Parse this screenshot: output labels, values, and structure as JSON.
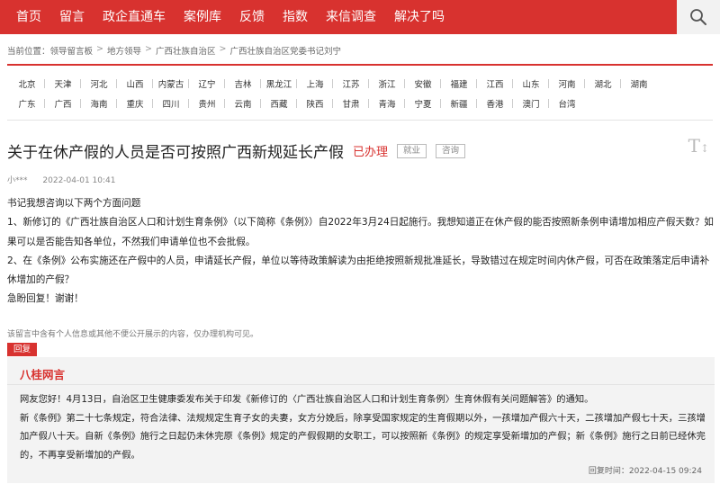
{
  "nav": {
    "items": [
      "首页",
      "留言",
      "政企直通车",
      "案例库",
      "反馈",
      "指数",
      "来信调查",
      "解决了吗"
    ]
  },
  "search": {
    "icon": "search-icon"
  },
  "breadcrumb": {
    "label": "当前位置：",
    "items": [
      "领导留言板",
      "地方领导",
      "广西壮族自治区",
      "广西壮族自治区党委书记刘宁"
    ],
    "separator": ">"
  },
  "regions": {
    "row1": [
      "北京",
      "天津",
      "河北",
      "山西",
      "内蒙古",
      "辽宁",
      "吉林",
      "黑龙江",
      "上海",
      "江苏",
      "浙江",
      "安徽",
      "福建",
      "江西",
      "山东",
      "河南",
      "湖北",
      "湖南"
    ],
    "row2": [
      "广东",
      "广西",
      "海南",
      "重庆",
      "四川",
      "贵州",
      "云南",
      "西藏",
      "陕西",
      "甘肃",
      "青海",
      "宁夏",
      "新疆",
      "香港",
      "澳门",
      "台湾"
    ]
  },
  "message": {
    "title": "关于在休产假的人员是否可按照广西新规延长产假",
    "status": "已办理",
    "tags": [
      "就业",
      "咨询"
    ],
    "font_toggle": "T",
    "author": "小***",
    "time": "2022-04-01 10:41",
    "body": [
      "书记我想咨询以下两个方面问题",
      "1、新修订的《广西壮族自治区人口和计划生育条例》（以下简称《条例》）自2022年3月24日起施行。我想知道正在休产假的能否按照新条例申请增加相应产假天数？如果可以是否能告知各单位，不然我们申请单位也不会批假。",
      "2、在《条例》公布实施还在产假中的人员，申请延长产假，单位以等待政策解读为由拒绝按照新规批准延长，导致错过在规定时间内休产假，可否在政策落定后申请补休增加的产假？",
      "急盼回复！谢谢！"
    ],
    "privacy_note": "该留言中含有个人信息或其他不便公开展示的内容，仅办理机构可见。"
  },
  "reply": {
    "tab_label": "回复",
    "org": "八桂网言",
    "body": [
      "网友您好！4月13日，自治区卫生健康委发布关于印发《新修订的〈广西壮族自治区人口和计划生育条例〉生育休假有关问题解答》的通知。",
      "新《条例》第二十七条规定，符合法律、法规规定生育子女的夫妻，女方分娩后，除享受国家规定的生育假期以外，一孩增加产假六十天，二孩增加产假七十天，三孩增加产假八十天。自新《条例》施行之日起仍未休完原《条例》规定的产假假期的女职工，可以按照新《条例》的规定享受新增加的产假；新《条例》施行之日前已经休完的，不再享受新增加的产假。"
    ],
    "time_label": "回复时间：",
    "time": "2022-04-15 09:24"
  },
  "colors": {
    "brand_red": "#d8322f",
    "reply_bg": "#f3f3f3"
  }
}
